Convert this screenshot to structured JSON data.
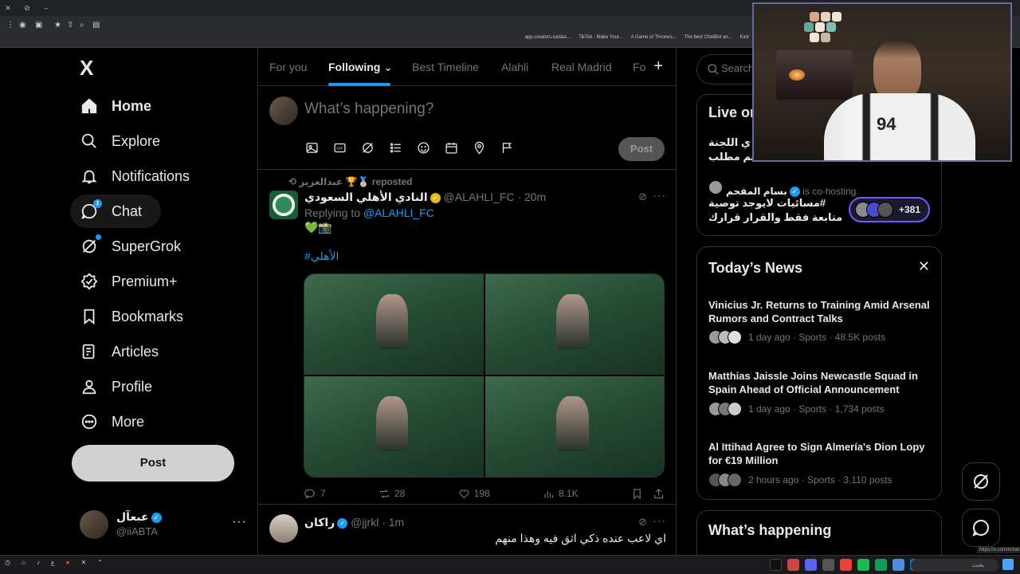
{
  "browser": {
    "bookmarks": [
      "app.creators.sa/das...",
      "TikTok - Make Your...",
      "A Game of Thrones...",
      "The best ChatBot an...",
      "Kick"
    ]
  },
  "nav": {
    "logo": "X",
    "items": [
      {
        "label": "Home",
        "icon": "home-icon",
        "bold": true
      },
      {
        "label": "Explore",
        "icon": "search-icon"
      },
      {
        "label": "Notifications",
        "icon": "bell-icon"
      },
      {
        "label": "Chat",
        "icon": "chat-icon",
        "badge": "1"
      },
      {
        "label": "SuperGrok",
        "icon": "grok-icon"
      },
      {
        "label": "Premium+",
        "icon": "premium-icon"
      },
      {
        "label": "Bookmarks",
        "icon": "bookmark-icon"
      },
      {
        "label": "Articles",
        "icon": "articles-icon"
      },
      {
        "label": "Profile",
        "icon": "person-icon"
      },
      {
        "label": "More",
        "icon": "more-circle-icon"
      }
    ],
    "post_label": "Post",
    "account": {
      "name": "عبعآل",
      "handle": "@iiABTA",
      "more": "···"
    }
  },
  "tabs": [
    "For you",
    "Following",
    "Best Timeline",
    "Alahli",
    "Real Madrid",
    "Fo"
  ],
  "active_tab": "Following",
  "composer": {
    "placeholder": "What’s happening?",
    "post_label": "Post"
  },
  "tweets": [
    {
      "repost_by": "عبدالعزيز 🏆🥈 reposted",
      "name": "النادي الأهلي السعودي",
      "handle": "@ALAHLI_FC · 20m",
      "replying_label": "Replying to",
      "replying_to": "@ALAHLI_FC",
      "text": "💚📸",
      "hashtag": "#الأهلي",
      "stats": {
        "replies": "7",
        "reposts": "28",
        "likes": "198",
        "views": "8.1K"
      }
    },
    {
      "name": "راكان",
      "handle": "@jjrkl · 1m",
      "text": "اي لاعب عنده ذكي اثق فيه وهذا منهم"
    }
  ],
  "right": {
    "search_placeholder": "Search",
    "live": {
      "title": "Live on",
      "line1": "#... ي اللجنة",
      "line2": "... هم مطلب",
      "cohost_name": "بسام المقحم",
      "cohost_suffix": "is co-hosting",
      "space_line1": "#مسائيات لايوجد توصية",
      "space_line2": "متابعة فقط والقرار قرارك",
      "listeners": "+381"
    },
    "news": {
      "title": "Today’s News",
      "close": "✕",
      "items": [
        {
          "headline": "Vinicius Jr. Returns to Training Amid Arsenal Rumors and Contract Talks",
          "meta": "1 day ago · Sports · 48.5K posts"
        },
        {
          "headline": "Matthias Jaissle Joins Newcastle Squad in Spain Ahead of Official Announcement",
          "meta": "1 day ago · Sports · 1,734 posts"
        },
        {
          "headline": "Al Ittihad Agree to Sign Almería's Dion Lopy for €19 Million",
          "meta": "2 hours ago · Sports · 3,110 posts"
        }
      ]
    },
    "happening_title": "What’s happening"
  },
  "webcam": {
    "jersey_number": "94"
  },
  "taskbar": {
    "search_text": "بحث"
  },
  "status_url": "https://x.com/i/chat",
  "colors": {
    "accent": "#1d9bf0",
    "background": "#000000",
    "border": "#2f3336",
    "muted": "#71767b"
  }
}
